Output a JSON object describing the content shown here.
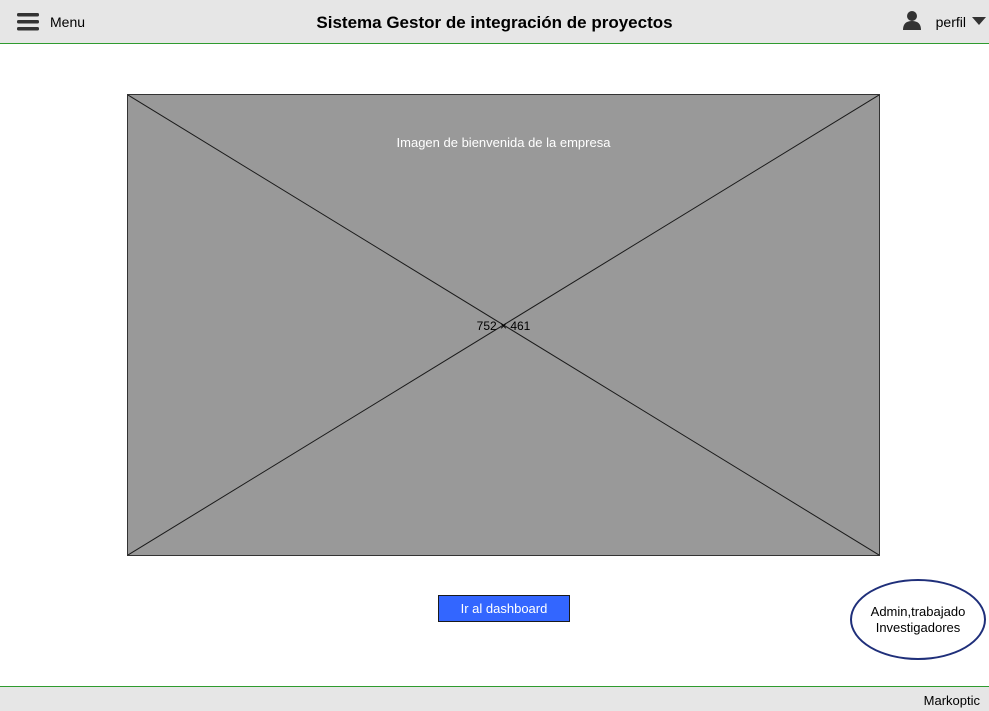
{
  "header": {
    "menu_label": "Menu",
    "title": "Sistema Gestor de integración de proyectos",
    "profile_label": "perfil",
    "icons": {
      "menu": "hamburger-icon",
      "user": "user-icon",
      "dropdown": "caret-down-icon"
    }
  },
  "main": {
    "image_placeholder": {
      "caption": "Imagen de bienvenida de la empresa",
      "size_label": "752 × 461"
    },
    "dashboard_button_label": "Ir al dashboard",
    "roles_note": {
      "line1": "Admin,trabajado",
      "line2": "Investigadores"
    }
  },
  "footer": {
    "brand": "Markoptic"
  },
  "colors": {
    "bar_background": "#e6e6e6",
    "bar_border": "#2e9b2e",
    "placeholder_fill": "#999999",
    "primary_button": "#3366ff",
    "note_border": "#1f2f7a"
  }
}
